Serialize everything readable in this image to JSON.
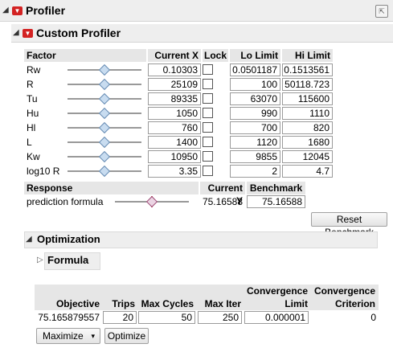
{
  "profiler": {
    "title": "Profiler"
  },
  "custom_profiler": {
    "title": "Custom Profiler",
    "columns": {
      "factor": "Factor",
      "current_x": "Current X",
      "lock": "Lock",
      "lo_limit": "Lo Limit",
      "hi_limit": "Hi Limit"
    },
    "factors": [
      {
        "name": "Rw",
        "current": "0.10303",
        "lo": "0.0501187",
        "hi": "0.1513561",
        "slider_level": 0.5
      },
      {
        "name": "R",
        "current": "25109",
        "lo": "100",
        "hi": "50118.723",
        "slider_level": 0.5
      },
      {
        "name": "Tu",
        "current": "89335",
        "lo": "63070",
        "hi": "115600",
        "slider_level": 0.5
      },
      {
        "name": "Hu",
        "current": "1050",
        "lo": "990",
        "hi": "1110",
        "slider_level": 0.5
      },
      {
        "name": "Hl",
        "current": "760",
        "lo": "700",
        "hi": "820",
        "slider_level": 0.5
      },
      {
        "name": "L",
        "current": "1400",
        "lo": "1120",
        "hi": "1680",
        "slider_level": 0.5
      },
      {
        "name": "Kw",
        "current": "10950",
        "lo": "9855",
        "hi": "12045",
        "slider_level": 0.5
      },
      {
        "name": "log10 R",
        "current": "3.35",
        "lo": "2",
        "hi": "4.7",
        "slider_level": 0.5
      }
    ],
    "response": {
      "header": "Response",
      "current_y_header": "Current Y",
      "benchmark_header": "Benchmark",
      "name": "prediction formula",
      "current_y": "75.16588",
      "benchmark": "75.16588",
      "slider_level": 0.5
    },
    "reset_benchmark_label": "Reset Benchmark"
  },
  "optimization": {
    "title": "Optimization",
    "formula_label": "Formula",
    "headers": {
      "objective": "Objective",
      "trips": "Trips",
      "max_cycles": "Max Cycles",
      "max_iter": "Max Iter",
      "convergence_limit_1": "Convergence",
      "convergence_limit_2": "Limit",
      "convergence_criterion_1": "Convergence",
      "convergence_criterion_2": "Criterion"
    },
    "values": {
      "objective": "75.165879557",
      "trips": "20",
      "max_cycles": "50",
      "max_iter": "250",
      "convergence_limit": "0.000001",
      "convergence_criterion": "0"
    },
    "maximize_label": "Maximize",
    "optimize_label": "Optimize"
  },
  "colors": {
    "red_menu": "#d32222",
    "slider_blue": "#c8dcf0",
    "response_line": "#c01b1b"
  }
}
